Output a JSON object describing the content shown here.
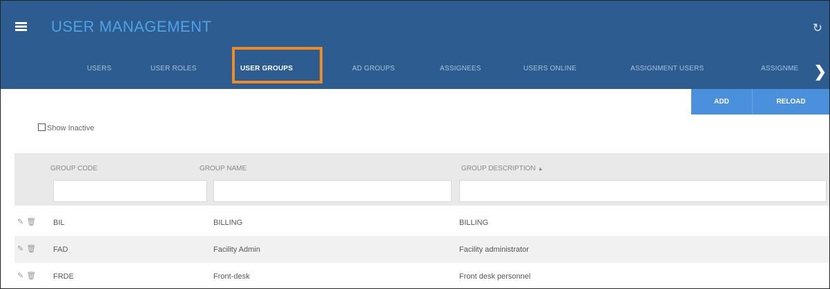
{
  "header": {
    "title": "USER MANAGEMENT",
    "menu_icon": "hamburger-menu-icon",
    "refresh_icon": "refresh-icon"
  },
  "tabs": [
    {
      "label": "USERS",
      "active": false
    },
    {
      "label": "USER ROLES",
      "active": false
    },
    {
      "label": "USER GROUPS",
      "active": true
    },
    {
      "label": "AD GROUPS",
      "active": false
    },
    {
      "label": "ASSIGNEES",
      "active": false
    },
    {
      "label": "USERS ONLINE",
      "active": false
    },
    {
      "label": "ASSIGNMENT USERS",
      "active": false
    },
    {
      "label": "ASSIGNME",
      "active": false
    }
  ],
  "toolbar": {
    "add_label": "ADD",
    "reload_label": "RELOAD"
  },
  "filter_options": {
    "show_inactive_label": "Show Inactive",
    "show_inactive_checked": false
  },
  "table": {
    "columns": [
      {
        "label": "GROUP CODE",
        "sorted": false
      },
      {
        "label": "GROUP NAME",
        "sorted": false
      },
      {
        "label": "GROUP DESCRIPTION",
        "sorted": true
      }
    ],
    "filters": [
      "",
      "",
      ""
    ],
    "rows": [
      {
        "code": "BIL",
        "name": "BILLING",
        "description": "BILLING"
      },
      {
        "code": "FAD",
        "name": "Facility Admin",
        "description": "Facility administrator"
      },
      {
        "code": "FRDE",
        "name": "Front-desk",
        "description": "Front desk personnel"
      }
    ]
  },
  "colors": {
    "header_bg": "#2d5d90",
    "title": "#4da3e6",
    "active_tab_highlight": "#f08a24",
    "button_bg": "#4a90dd"
  }
}
